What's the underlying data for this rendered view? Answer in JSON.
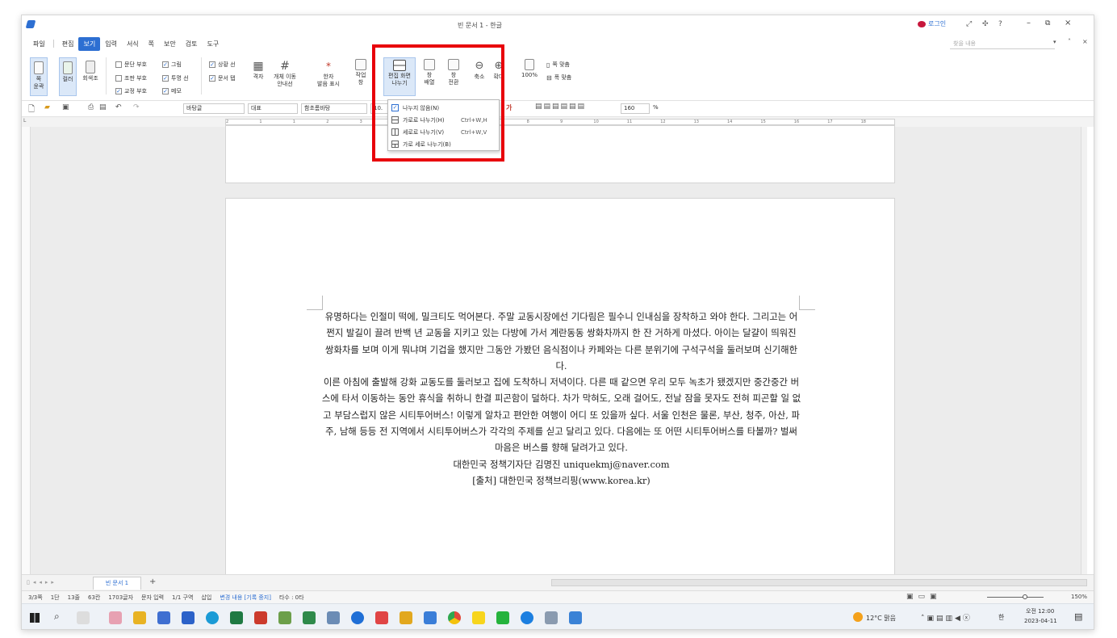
{
  "window": {
    "title": "빈 문서 1 - 한글",
    "login_label": "로그인",
    "help_glyph": "?",
    "search_placeholder": "찾을 내용"
  },
  "menubar": {
    "items": [
      "파일",
      "편집",
      "보기",
      "입력",
      "서식",
      "쪽",
      "보안",
      "검토",
      "도구"
    ],
    "active_index": 2
  },
  "ribbon": {
    "view_buttons": [
      {
        "label1": "쪽",
        "label2": "윤곽"
      },
      {
        "label1": "컬러",
        "label2": ""
      },
      {
        "label1": "회색조",
        "label2": ""
      }
    ],
    "checkboxes_col1": [
      {
        "label": "문단 부호",
        "checked": false
      },
      {
        "label": "조판 부호",
        "checked": false
      },
      {
        "label": "교정 부호",
        "checked": true
      }
    ],
    "checkboxes_col2": [
      {
        "label": "그림",
        "checked": true
      },
      {
        "label": "투명 선",
        "checked": true
      },
      {
        "label": "메모",
        "checked": true
      }
    ],
    "checkboxes_col3": [
      {
        "label": "상황 선",
        "checked": true
      },
      {
        "label": "문서 탭",
        "checked": true
      }
    ],
    "grid_label": "격자",
    "object_move_label1": "개체 이동",
    "object_move_label2": "안내선",
    "hanja_label1": "한자",
    "hanja_label2": "발음 표시",
    "workspace_label1": "작업",
    "workspace_label2": "창",
    "split_label1": "편집 화면",
    "split_label2": "나누기",
    "arrange_label1": "창",
    "arrange_label2": "배열",
    "switch_label1": "창",
    "switch_label2": "전환",
    "zoom_out_label": "축소",
    "zoom_in_label": "확대",
    "zoom_100_label": "100%",
    "fit_width_label": "쪽 맞춤",
    "fit_page_label": "폭 맞춤"
  },
  "toolbar2": {
    "style": "바탕글",
    "lang": "대표",
    "font": "함초롬바탕",
    "size": "10.",
    "zoom_value": "160",
    "zoom_unit": "%"
  },
  "split_menu": {
    "items": [
      {
        "label": "나누지 않음(N)",
        "shortcut": "",
        "checked": true
      },
      {
        "label": "가로로 나누기(H)",
        "shortcut": "Ctrl+W,H",
        "checked": false
      },
      {
        "label": "세로로 나누기(V)",
        "shortcut": "Ctrl+W,V",
        "checked": false
      },
      {
        "label": "가로 세로 나누기(B)",
        "shortcut": "",
        "checked": false
      }
    ]
  },
  "ruler": {
    "ticks": [
      "2",
      "1",
      "1",
      "2",
      "3",
      "4",
      "5",
      "6",
      "7",
      "8",
      "9",
      "10",
      "11",
      "12",
      "13",
      "14",
      "15",
      "16",
      "17",
      "18"
    ]
  },
  "document": {
    "paragraphs": [
      "유명하다는 인절미 떡에, 밀크티도 먹어본다. 주말 교동시장에선 기다림은 필수니 인내심을 장착하고 와야 한다. 그리고는 어쩐지 발길이 끌려 반백 년 교동을 지키고 있는 다방에 가서 계란동동 쌍화차까지 한 잔 거하게 마셨다. 아이는 달걀이 띄워진 쌍화차를 보며 이게 뭐냐며 기겁을 했지만 그동안 가봤던 음식점이나 카페와는 다른 분위기에 구석구석을 둘러보며 신기해한다.",
      "이른 아침에 출발해 강화 교동도를 둘러보고 집에 도착하니 저녁이다. 다른 때 같으면 우리 모두 녹초가 됐겠지만 중간중간 버스에 타서 이동하는 동안 휴식을 취하니 한결 피곤함이 덜하다. 차가 막혀도, 오래 걸어도, 전날 잠을 못자도 전혀 피곤할 일 없고 부담스럽지 않은 시티투어버스! 이렇게 알차고 편안한 여행이 어디 또 있을까 싶다. 서울 인천은 물론, 부산, 청주, 아산, 파주, 남해 등등 전 지역에서 시티투어버스가 각각의 주제를 싣고 달리고 있다. 다음에는 또 어떤 시티투어버스를 타볼까? 벌써 마음은 버스를 향해 달려가고 있다.",
      "대한민국 정책기자단 김명진 uniquekmj@naver.com",
      "[출처] 대한민국 정책브리핑(www.korea.kr)"
    ]
  },
  "doc_tabs": {
    "active_tab": "빈 문서 1",
    "add_glyph": "+"
  },
  "statusbar": {
    "items": [
      "3/3쪽",
      "1단",
      "13줄",
      "63칸",
      "1703글자",
      "문자 입력",
      "1/1 구역",
      "삽입",
      "변경 내용 [기록 중지]",
      "타수 : 0타"
    ],
    "zoom": "150%"
  },
  "taskbar": {
    "weather": "12°C 맑음",
    "time": "오전 12:00",
    "date": "2023-04-11",
    "ime": "한"
  },
  "colors": {
    "accent": "#2d6fd2",
    "highlight_box": "#e8000a",
    "doc_background": "#ececec"
  }
}
